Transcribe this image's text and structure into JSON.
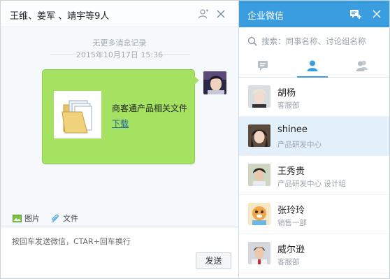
{
  "chat": {
    "title": "王维、姜军 、靖宇等9人",
    "no_more": "无更多消息记录",
    "timestamp": "2015年10月17日   15:36",
    "message": {
      "file_name": "商客通产品相关文件",
      "download_label": "下载"
    },
    "tools": {
      "image_label": "图片",
      "file_label": "文件"
    },
    "input_hint": "按回车发送微信，CTAR+回车换行",
    "send_label": "发送"
  },
  "sidebar": {
    "title": "企业微信",
    "search_placeholder": "搜索：同事名称、讨论组名称",
    "contacts": [
      {
        "name": "胡杨",
        "dept": "客服部"
      },
      {
        "name": "shinee",
        "dept": "产品研发中心",
        "selected": true
      },
      {
        "name": "王秀贵",
        "dept": "产品研发中心   设计组"
      },
      {
        "name": "张玲玲",
        "dept": "销售一部"
      },
      {
        "name": "威尔逊",
        "dept": "客服部"
      }
    ]
  },
  "colors": {
    "accent": "#3a9de0",
    "bubble": "#a5e262",
    "selected_row": "#e3f0fb"
  }
}
